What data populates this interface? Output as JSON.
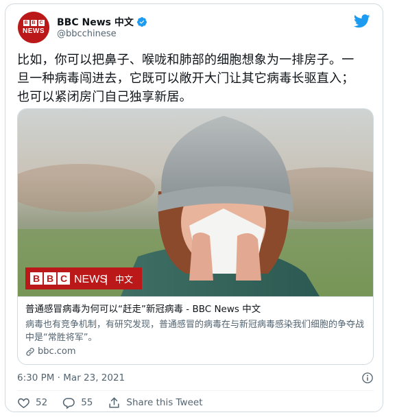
{
  "author": {
    "display_name": "BBC News 中文",
    "handle": "@bbcchinese",
    "avatar_label": "BBC NEWS"
  },
  "tweet": {
    "text_lines": [
      "比如，你可以把鼻子、喉咙和肺部的细胞想象为一排房子。一",
      "旦一种病毒闯进去，它既可以敞开大门让其它病毒长驱直入；",
      "也可以紧闭房门自己独享新居。"
    ],
    "timestamp": "6:30 PM · Mar 23, 2021"
  },
  "card": {
    "image_banner": {
      "brand": "BBC",
      "news": "NEWS",
      "separator": "|",
      "lang": "中文"
    },
    "title": "普通感冒病毒为何可以“赶走”新冠病毒 - BBC News 中文",
    "description": "病毒也有竞争机制，有研究发现，普通感冒的病毒在与新冠病毒感染我们细胞的争夺战中是“常胜将军”。",
    "domain": "bbc.com"
  },
  "actions": {
    "likes": "52",
    "replies": "55",
    "share_label": "Share this Tweet"
  },
  "colors": {
    "bbc_red": "#bb1919",
    "twitter_blue": "#1d9bf0",
    "like_red": "#f91880",
    "secondary_text": "#536471"
  },
  "icons": [
    "verified-badge-icon",
    "twitter-bird-icon",
    "link-icon",
    "info-icon",
    "heart-icon",
    "reply-icon",
    "share-icon"
  ]
}
